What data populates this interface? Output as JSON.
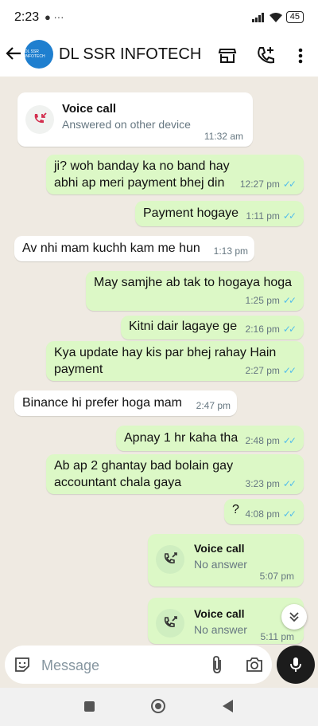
{
  "status": {
    "time": "2:23",
    "battery": "45",
    "notif": "● ···"
  },
  "header": {
    "contact": "DL SSR INFOTECH",
    "avatar_text": "DL SSR INFOTECH"
  },
  "messages": [
    {
      "type": "call",
      "direction": "in",
      "title": "Voice call",
      "subtitle": "Answered on other device",
      "time": "11:32 am"
    },
    {
      "type": "text",
      "direction": "out",
      "text": "ji? woh banday ka no band hay abhi ap meri payment bhej din",
      "time": "12:27 pm"
    },
    {
      "type": "text",
      "direction": "out",
      "text": "Payment hogaye",
      "time": "1:11 pm"
    },
    {
      "type": "text",
      "direction": "in",
      "text": "Av nhi mam kuchh kam me hun",
      "time": "1:13 pm"
    },
    {
      "type": "text",
      "direction": "out",
      "text": "May samjhe ab tak to hogaya hoga",
      "time": "1:25 pm"
    },
    {
      "type": "text",
      "direction": "out",
      "text": "Kitni dair lagaye ge",
      "time": "2:16 pm"
    },
    {
      "type": "text",
      "direction": "out",
      "text": "Kya update hay kis par bhej rahay Hain payment",
      "time": "2:27 pm"
    },
    {
      "type": "text",
      "direction": "in",
      "text": "Binance hi prefer hoga mam",
      "time": "2:47 pm"
    },
    {
      "type": "text",
      "direction": "out",
      "text": "Apnay 1 hr kaha tha",
      "time": "2:48 pm"
    },
    {
      "type": "text",
      "direction": "out",
      "text": "Ab ap 2 ghantay bad bolain gay accountant chala gaya",
      "time": "3:23 pm"
    },
    {
      "type": "text",
      "direction": "out",
      "text": "?",
      "time": "4:08 pm"
    },
    {
      "type": "call",
      "direction": "out",
      "title": "Voice call",
      "subtitle": "No answer",
      "time": "5:07 pm"
    },
    {
      "type": "call",
      "direction": "out",
      "title": "Voice call",
      "subtitle": "No answer",
      "time": "5:11 pm"
    }
  ],
  "composer": {
    "placeholder": "Message"
  },
  "colors": {
    "outgoing": "#dcf8c6",
    "incoming": "#ffffff",
    "read_ticks": "#53bdeb",
    "missed_call": "#d32f4f",
    "mic_button": "#1c1c1c"
  },
  "icons": [
    "back-arrow-icon",
    "store-icon",
    "add-call-icon",
    "more-vert-icon",
    "missed-call-icon",
    "phone-call-icon",
    "chevron-double-down-icon",
    "sticker-icon",
    "attach-icon",
    "camera-icon",
    "mic-icon"
  ]
}
